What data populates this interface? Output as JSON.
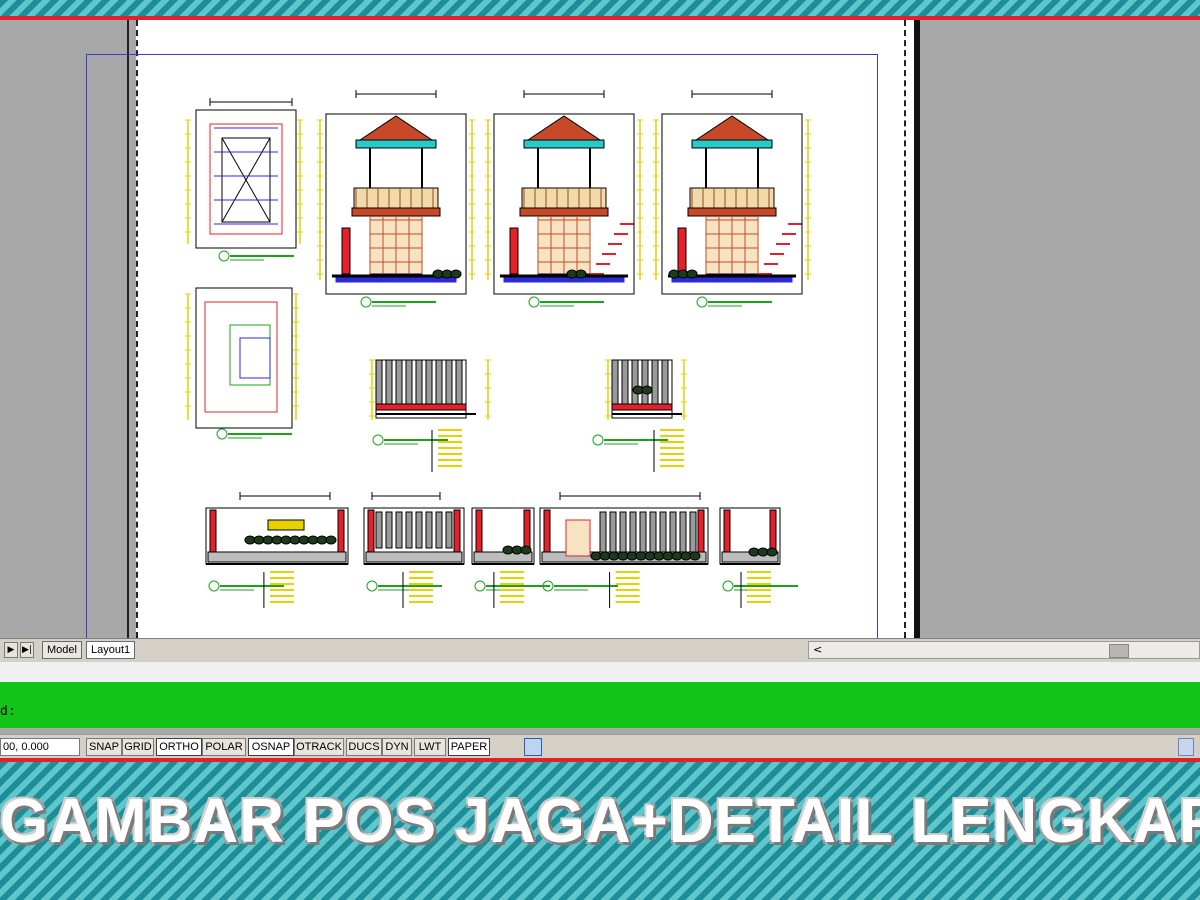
{
  "layout_tabs": [
    {
      "label": "Model",
      "active": false
    },
    {
      "label": "Layout1",
      "active": true
    }
  ],
  "command": {
    "prompt": "d:"
  },
  "status": {
    "coordinates": "00, 0.000",
    "toggles": [
      {
        "label": "SNAP",
        "on": false
      },
      {
        "label": "GRID",
        "on": false
      },
      {
        "label": "ORTHO",
        "on": true
      },
      {
        "label": "POLAR",
        "on": false
      },
      {
        "label": "OSNAP",
        "on": true
      },
      {
        "label": "OTRACK",
        "on": false
      },
      {
        "label": "DUCS",
        "on": false
      },
      {
        "label": "DYN",
        "on": false
      },
      {
        "label": "LWT",
        "on": false
      },
      {
        "label": "PAPER",
        "on": true
      }
    ]
  },
  "title": "GAMBAR POS JAGA+DETAIL LENGKAP",
  "colors": {
    "banner_red": "#e5202a",
    "command_green": "#12c418",
    "teal": "#2a9aa4"
  }
}
